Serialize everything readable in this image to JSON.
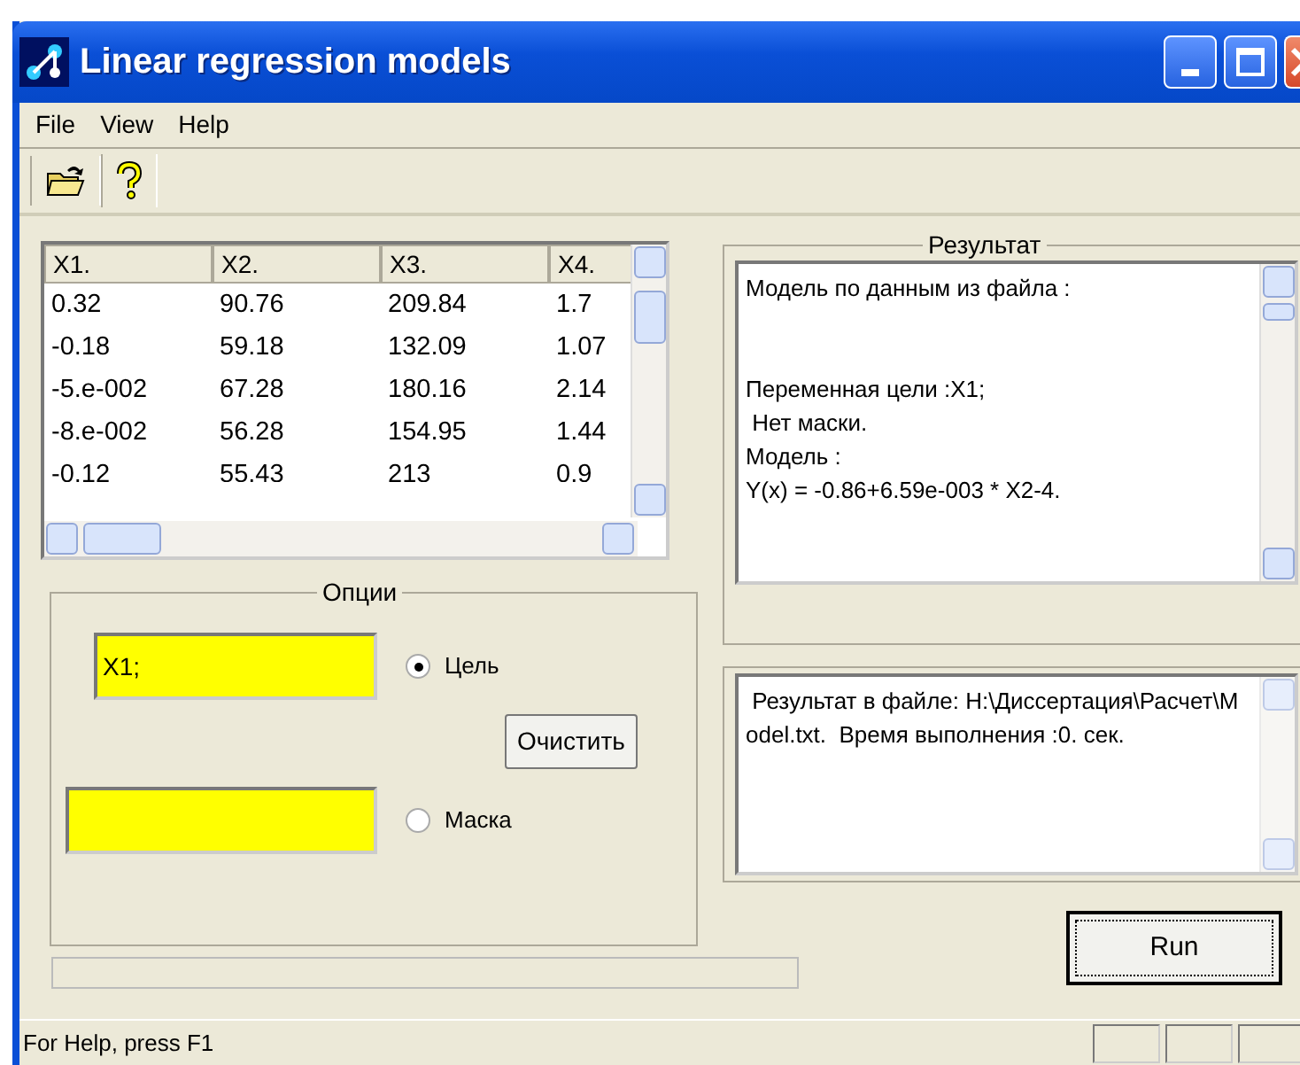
{
  "window": {
    "title": "Linear regression models"
  },
  "menu": [
    "File",
    "View",
    "Help"
  ],
  "table": {
    "columns": [
      "X1.",
      "X2.",
      "X3.",
      "X4."
    ],
    "rows": [
      [
        "0.32",
        "90.76",
        "209.84",
        "1.7"
      ],
      [
        "-0.18",
        "59.18",
        "132.09",
        "1.07"
      ],
      [
        "-5.e-002",
        "67.28",
        "180.16",
        "2.14"
      ],
      [
        "-8.e-002",
        "56.28",
        "154.95",
        "1.44"
      ],
      [
        "-0.12",
        "55.43",
        "213",
        "0.9"
      ]
    ]
  },
  "options": {
    "title": "Опции",
    "target_value": "X1;",
    "radios": [
      {
        "label": "Цель",
        "selected": true
      },
      {
        "label": "Маска",
        "selected": false
      }
    ],
    "clear_button": "Очистить"
  },
  "progress": {
    "level": 0
  },
  "result": {
    "title": "Результат",
    "lines": [
      "Модель по данным из файла :",
      "Переменная цели :X1;",
      " Нет маски.",
      "Модель :",
      "Y(x) = -0.86+6.59e-003 * X2-4."
    ],
    "file_text": " Результат в файле: H:\\Диссертация\\Расчет\\Model.txt.  Время выполнения :0. сек."
  },
  "run_button": "Run",
  "status_bar": "For Help, press F1"
}
